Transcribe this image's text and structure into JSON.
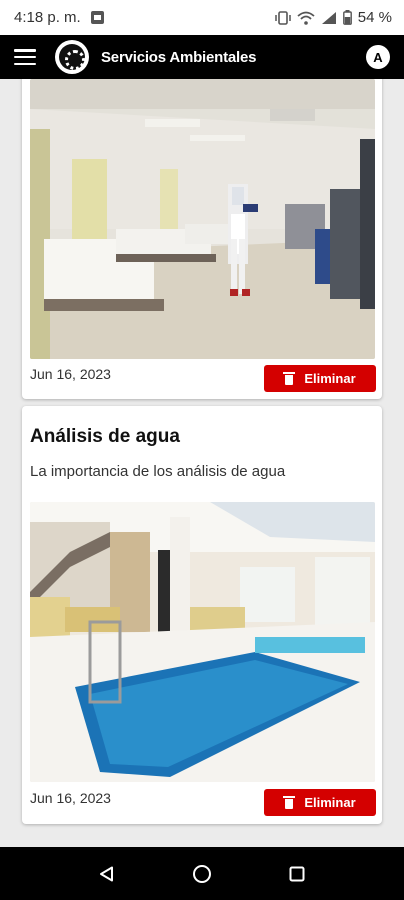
{
  "status_bar": {
    "time": "4:18 p. m.",
    "battery": "54 %",
    "icons": [
      "image-icon",
      "vibrate-icon",
      "wifi-icon",
      "signal-icon",
      "battery-icon"
    ]
  },
  "app_bar": {
    "title": "Servicios Ambientales",
    "avatar_letter": "A",
    "icons": [
      "menu-icon",
      "logo-icon"
    ]
  },
  "cards": [
    {
      "title": "",
      "description": "",
      "image": "hospital-room-disinfection-photo",
      "date": "Jun 16, 2023",
      "delete_label": "Eliminar"
    },
    {
      "title": "Análisis de agua",
      "description": "La importancia de los análisis de agua",
      "image": "indoor-pool-photo",
      "date": "Jun 16, 2023",
      "delete_label": "Eliminar"
    }
  ],
  "nav_bar": {
    "icons": [
      "back-icon",
      "home-icon",
      "recents-icon"
    ]
  },
  "colors": {
    "app_bar": "#000000",
    "delete_button": "#d40000",
    "background": "#ebebeb"
  }
}
